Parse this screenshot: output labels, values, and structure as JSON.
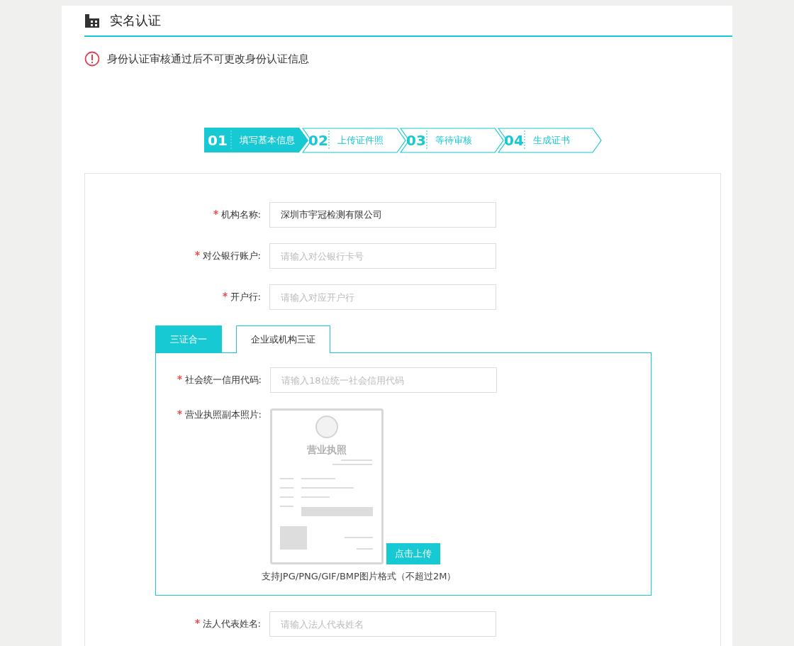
{
  "header": {
    "title": "实名认证"
  },
  "notice": {
    "text": "身份认证审核通过后不可更改身份认证信息"
  },
  "steps": [
    {
      "number": "01",
      "label": "填写基本信息",
      "selected": true
    },
    {
      "number": "02",
      "label": "上传证件照",
      "selected": false
    },
    {
      "number": "03",
      "label": "等待审核",
      "selected": false
    },
    {
      "number": "04",
      "label": "生成证书",
      "selected": false
    }
  ],
  "fields": [
    {
      "label": "机构名称:",
      "required": true,
      "value": "深圳市宇冠检测有限公司"
    },
    {
      "label": "对公银行账户:",
      "required": true,
      "placeholder": "请输入对公银行卡号"
    },
    {
      "label": "开户行:",
      "required": true,
      "placeholder": "请输入对应开户行"
    }
  ],
  "cert_tabs": [
    {
      "label": "三证合一",
      "selected": true
    },
    {
      "label": "企业或机构三证",
      "selected": false
    }
  ],
  "cert_panel": {
    "code_field": {
      "label": "社会统一信用代码:",
      "required": true,
      "placeholder": "请输入18位统一社会信用代码"
    },
    "license": {
      "label": "营业执照副本照片:",
      "required": true,
      "sample_title": "营业执照",
      "upload_button": "点击上传",
      "hint": "支持JPG/PNG/GIF/BMP图片格式（不超过2M）"
    }
  },
  "bottom_fields": [
    {
      "label": "法人代表姓名:",
      "required": true,
      "placeholder": "请输入法人代表姓名"
    }
  ]
}
